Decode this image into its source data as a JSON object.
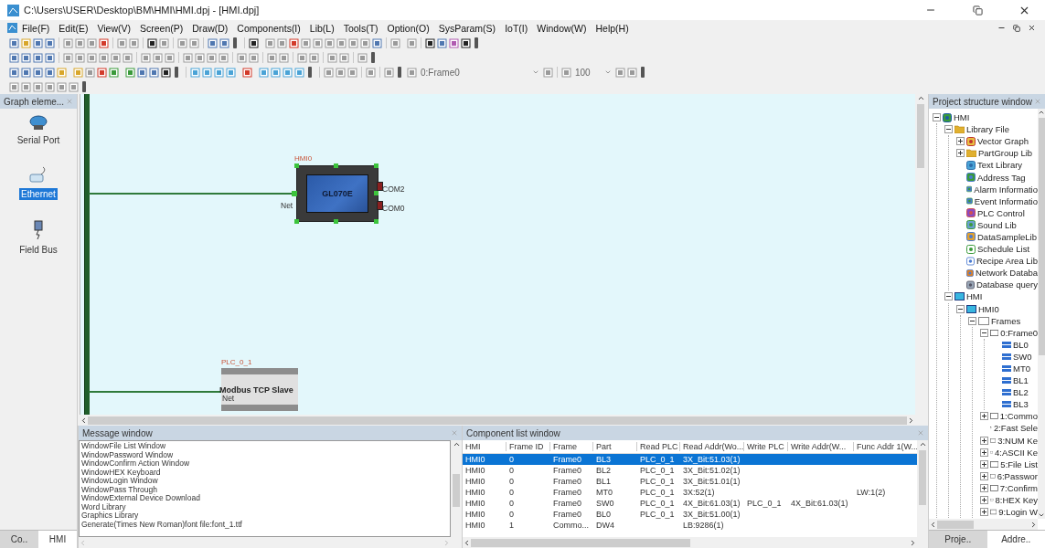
{
  "window": {
    "title": "C:\\Users\\USER\\Desktop\\BM\\HMI\\HMI.dpj - [HMI.dpj]"
  },
  "menu": [
    "File(F)",
    "Edit(E)",
    "View(V)",
    "Screen(P)",
    "Draw(D)",
    "Components(I)",
    "Lib(L)",
    "Tools(T)",
    "Option(O)",
    "SysParam(S)",
    "IoT(I)",
    "Window(W)",
    "Help(H)"
  ],
  "toolbar": {
    "frame_select": "0:Frame0",
    "zoom": "100"
  },
  "graph_elements": {
    "title": "Graph eleme...",
    "items": [
      {
        "label": "Serial Port",
        "kind": "serial",
        "selected": false
      },
      {
        "label": "Ethernet",
        "kind": "ethernet",
        "selected": true
      },
      {
        "label": "Field Bus",
        "kind": "fieldbus",
        "selected": false
      }
    ]
  },
  "left_tabs": [
    {
      "label": "Co..",
      "selected": true
    },
    {
      "label": "HMI",
      "selected": false
    }
  ],
  "canvas": {
    "nodes": [
      {
        "kind": "hmi",
        "name": "HMI0",
        "model": "GL070E",
        "ports": [
          "Net",
          "COM2",
          "COM0"
        ]
      },
      {
        "kind": "plc",
        "name": "PLC_0_1",
        "model": "Modbus TCP Slave",
        "ports": [
          "Net"
        ]
      }
    ]
  },
  "message_window": {
    "title": "Message window",
    "lines": [
      "WindowFile List Window",
      "WindowPassword Window",
      "WindowConfirm Action Window",
      "WindowHEX Keyboard",
      "WindowLogin Window",
      "WindowPass Through",
      "WindowExternal Device Download",
      "Word Library",
      "Graphics Library",
      "Generate(Times New Roman)font file:font_1.ttf"
    ]
  },
  "component_list": {
    "title": "Component list window",
    "columns": [
      "HMI",
      "Frame ID",
      "Frame",
      "Part",
      "Read PLC",
      "Read Addr(Wo...",
      "Write PLC",
      "Write Addr(W...",
      "Func Addr 1(W..."
    ],
    "rows": [
      {
        "cells": [
          "HMI0",
          "0",
          "Frame0",
          "BL3",
          "PLC_0_1",
          "3X_Bit:51.03(1)",
          "",
          "",
          ""
        ],
        "selected": true
      },
      {
        "cells": [
          "HMI0",
          "0",
          "Frame0",
          "BL2",
          "PLC_0_1",
          "3X_Bit:51.02(1)",
          "",
          "",
          ""
        ],
        "selected": false
      },
      {
        "cells": [
          "HMI0",
          "0",
          "Frame0",
          "BL1",
          "PLC_0_1",
          "3X_Bit:51.01(1)",
          "",
          "",
          ""
        ],
        "selected": false
      },
      {
        "cells": [
          "HMI0",
          "0",
          "Frame0",
          "MT0",
          "PLC_0_1",
          "3X:52(1)",
          "",
          "",
          "LW:1(2)"
        ],
        "selected": false
      },
      {
        "cells": [
          "HMI0",
          "0",
          "Frame0",
          "SW0",
          "PLC_0_1",
          "4X_Bit:61.03(1)",
          "PLC_0_1",
          "4X_Bit:61.03(1)",
          ""
        ],
        "selected": false
      },
      {
        "cells": [
          "HMI0",
          "0",
          "Frame0",
          "BL0",
          "PLC_0_1",
          "3X_Bit:51.00(1)",
          "",
          "",
          ""
        ],
        "selected": false
      },
      {
        "cells": [
          "HMI0",
          "1",
          "Commo...",
          "DW4",
          "",
          "LB:9286(1)",
          "",
          "",
          ""
        ],
        "selected": false
      }
    ]
  },
  "project_structure": {
    "title": "Project structure window",
    "tree": [
      {
        "label": "HMI",
        "kind": "project",
        "expanded": true,
        "children": [
          {
            "label": "Library File",
            "kind": "folder",
            "expanded": true,
            "children": [
              {
                "label": "Vector Graph",
                "kind": "vector",
                "expanded": false
              },
              {
                "label": "PartGroup Lib",
                "kind": "folder",
                "expanded": false
              },
              {
                "label": "Text Library",
                "kind": "text"
              },
              {
                "label": "Address Tag",
                "kind": "tag"
              },
              {
                "label": "Alarm Informatio",
                "kind": "alarm"
              },
              {
                "label": "Event Informatio",
                "kind": "alarm"
              },
              {
                "label": "PLC Control",
                "kind": "plc"
              },
              {
                "label": "Sound Lib",
                "kind": "sound"
              },
              {
                "label": "DataSampleLib",
                "kind": "sample"
              },
              {
                "label": "Schedule List",
                "kind": "schedule"
              },
              {
                "label": "Recipe Area Lib",
                "kind": "recipe"
              },
              {
                "label": "Network Databa",
                "kind": "network"
              },
              {
                "label": "Database query",
                "kind": "query"
              }
            ]
          },
          {
            "label": "HMI",
            "kind": "device",
            "expanded": true,
            "children": [
              {
                "label": "HMI0",
                "kind": "device",
                "expanded": true,
                "children": [
                  {
                    "label": "Frames",
                    "kind": "frames",
                    "expanded": true,
                    "children": [
                      {
                        "label": "0:Frame0",
                        "kind": "frame",
                        "expanded": true,
                        "children": [
                          {
                            "label": "BL0",
                            "kind": "part"
                          },
                          {
                            "label": "SW0",
                            "kind": "part"
                          },
                          {
                            "label": "MT0",
                            "kind": "part"
                          },
                          {
                            "label": "BL1",
                            "kind": "part"
                          },
                          {
                            "label": "BL2",
                            "kind": "part"
                          },
                          {
                            "label": "BL3",
                            "kind": "part"
                          }
                        ]
                      },
                      {
                        "label": "1:Commo",
                        "kind": "frame",
                        "expanded": false
                      },
                      {
                        "label": "2:Fast Sele",
                        "kind": "frame"
                      },
                      {
                        "label": "3:NUM Ke",
                        "kind": "frame",
                        "expanded": false
                      },
                      {
                        "label": "4:ASCII Ke",
                        "kind": "frame",
                        "expanded": false
                      },
                      {
                        "label": "5:File List",
                        "kind": "frame",
                        "expanded": false
                      },
                      {
                        "label": "6:Passwor",
                        "kind": "frame",
                        "expanded": false
                      },
                      {
                        "label": "7:Confirm",
                        "kind": "frame",
                        "expanded": false
                      },
                      {
                        "label": "8:HEX Key",
                        "kind": "frame",
                        "expanded": false
                      },
                      {
                        "label": "9:Login W",
                        "kind": "frame",
                        "expanded": false
                      }
                    ]
                  }
                ]
              }
            ]
          }
        ]
      }
    ]
  },
  "right_tabs": [
    {
      "label": "Proje..",
      "selected": true
    },
    {
      "label": "Addre..",
      "selected": false
    }
  ]
}
